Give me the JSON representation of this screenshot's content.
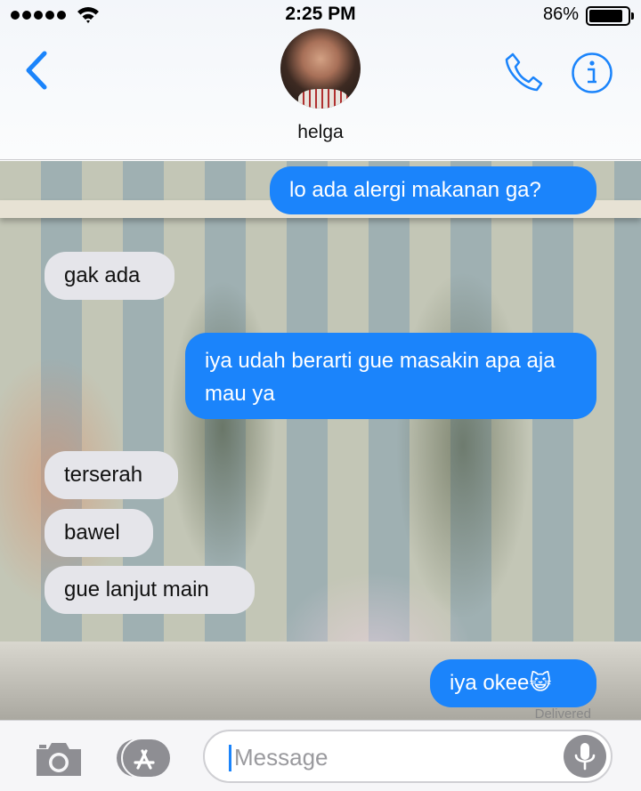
{
  "status_bar": {
    "time": "2:25 PM",
    "battery": "86%"
  },
  "header": {
    "contact_name": "helga"
  },
  "messages": [
    {
      "side": "out",
      "text": "lo ada alergi makanan ga?"
    },
    {
      "side": "in",
      "text": "gak ada"
    },
    {
      "side": "out",
      "text": "iya udah berarti gue masakin apa aja mau ya"
    },
    {
      "side": "in",
      "text": "terserah"
    },
    {
      "side": "in",
      "text": "bawel"
    },
    {
      "side": "in",
      "text": "gue lanjut main"
    },
    {
      "side": "out",
      "text": "iya okee😺"
    }
  ],
  "delivered": "Delivered",
  "input": {
    "placeholder": "Message"
  },
  "colors": {
    "outgoing_bubble": "#1b84fb",
    "incoming_bubble": "#e5e5ea",
    "accent": "#1b84fb"
  },
  "icons": [
    "back-chevron-icon",
    "phone-icon",
    "info-icon",
    "camera-icon",
    "app-store-icon",
    "microphone-icon",
    "wifi-icon",
    "battery-icon",
    "signal-icon"
  ]
}
